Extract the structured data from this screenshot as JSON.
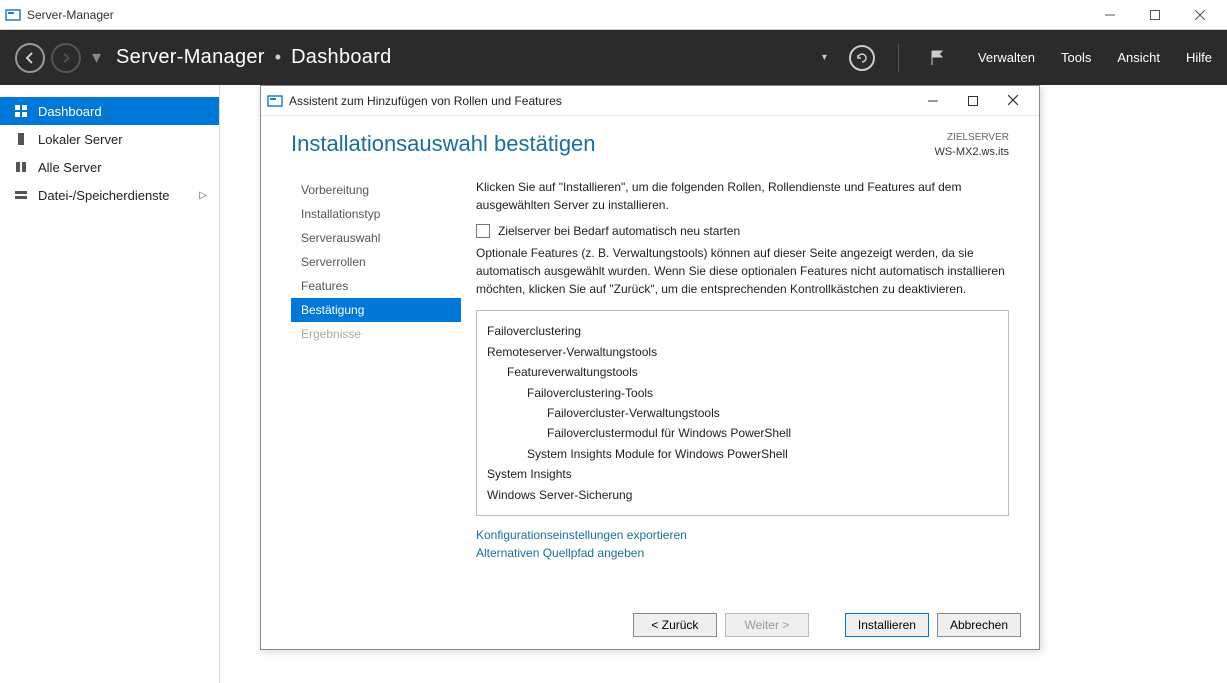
{
  "outer_window": {
    "title": "Server-Manager"
  },
  "header": {
    "app_name": "Server-Manager",
    "page": "Dashboard",
    "menus": {
      "verwalten": "Verwalten",
      "tools": "Tools",
      "ansicht": "Ansicht",
      "hilfe": "Hilfe"
    }
  },
  "sidebar": {
    "items": [
      {
        "label": "Dashboard",
        "icon": "dashboard-icon",
        "active": true
      },
      {
        "label": "Lokaler Server",
        "icon": "server-icon",
        "active": false
      },
      {
        "label": "Alle Server",
        "icon": "servers-icon",
        "active": false
      },
      {
        "label": "Datei-/Speicherdienste",
        "icon": "storage-icon",
        "active": false,
        "expandable": true
      }
    ]
  },
  "dialog": {
    "title": "Assistent zum Hinzufügen von Rollen und Features",
    "heading": "Installationsauswahl bestätigen",
    "target_label": "ZIELSERVER",
    "target_server": "WS-MX2.ws.its",
    "nav": [
      {
        "label": "Vorbereitung",
        "state": "normal"
      },
      {
        "label": "Installationstyp",
        "state": "normal"
      },
      {
        "label": "Serverauswahl",
        "state": "normal"
      },
      {
        "label": "Serverrollen",
        "state": "normal"
      },
      {
        "label": "Features",
        "state": "normal"
      },
      {
        "label": "Bestätigung",
        "state": "active"
      },
      {
        "label": "Ergebnisse",
        "state": "disabled"
      }
    ],
    "intro": "Klicken Sie auf \"Installieren\", um die folgenden Rollen, Rollendienste und Features auf dem ausgewählten Server zu installieren.",
    "checkbox_label": "Zielserver bei Bedarf automatisch neu starten",
    "note": "Optionale Features (z. B. Verwaltungstools) können auf dieser Seite angezeigt werden, da sie automatisch ausgewählt wurden. Wenn Sie diese optionalen Features nicht automatisch installieren möchten, klicken Sie auf \"Zurück\", um die entsprechenden Kontrollkästchen zu deaktivieren.",
    "features": [
      {
        "text": "Failoverclustering",
        "indent": 0
      },
      {
        "text": "Remoteserver-Verwaltungstools",
        "indent": 0
      },
      {
        "text": "Featureverwaltungstools",
        "indent": 1
      },
      {
        "text": "Failoverclustering-Tools",
        "indent": 2
      },
      {
        "text": "Failovercluster-Verwaltungstools",
        "indent": 3
      },
      {
        "text": "Failoverclustermodul für Windows PowerShell",
        "indent": 3
      },
      {
        "text": "System Insights Module for Windows PowerShell",
        "indent": 2
      },
      {
        "text": "System Insights",
        "indent": 0
      },
      {
        "text": "Windows Server-Sicherung",
        "indent": 0
      }
    ],
    "links": {
      "export": "Konfigurationseinstellungen exportieren",
      "altpath": "Alternativen Quellpfad angeben"
    },
    "buttons": {
      "back": "< Zurück",
      "next": "Weiter >",
      "install": "Installieren",
      "cancel": "Abbrechen"
    }
  }
}
